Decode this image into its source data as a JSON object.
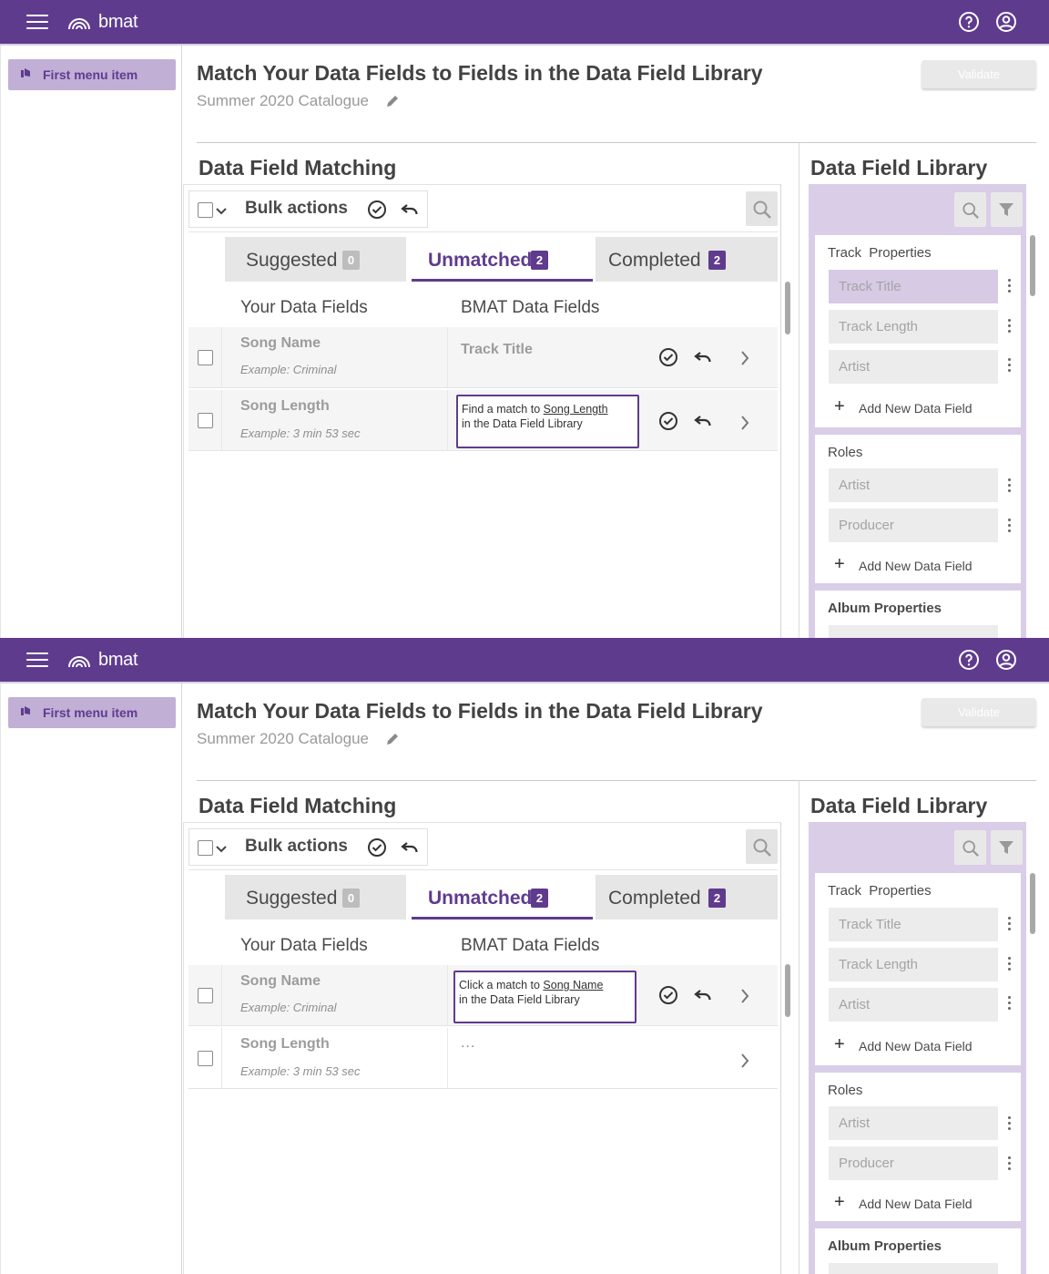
{
  "app": {
    "logo_text": "bmat",
    "brand_color": "#5f3b8e",
    "icons": {
      "menu": "hamburger-icon",
      "help": "help-circle-icon",
      "account": "account-circle-icon"
    }
  },
  "sidebar": {
    "menu_item": "First menu item",
    "menu_item_icon": "reorder-icon"
  },
  "header": {
    "title": "Match Your Data Fields to Fields in the Data Field Library",
    "subtitle": "Summer 2020 Catalogue",
    "validate_label": "Validate"
  },
  "matching": {
    "title": "Data Field Matching",
    "bulk_label": "Bulk actions",
    "tabs": [
      {
        "label": "Suggested",
        "count": "0",
        "badge_color": "#bdbdbd"
      },
      {
        "label": "Unmatched",
        "count": "2",
        "badge_color": "#5f3b8e",
        "active": true
      },
      {
        "label": "Completed",
        "count": "2",
        "badge_color": "#5f3b8e"
      }
    ],
    "col_your": "Your Data Fields",
    "col_bmat": "BMAT Data Fields"
  },
  "panels": [
    {
      "rows": [
        {
          "name": "Song Name",
          "example": "Example: Criminal",
          "bmat": "Track Title"
        },
        {
          "name": "Song Length",
          "example": "Example: 3 min 53 sec"
        }
      ],
      "tooltip": {
        "prefix": "Find a match to",
        "field": "Song Length",
        "suffix": "in the Data Field Library"
      }
    },
    {
      "rows": [
        {
          "name": "Song Name",
          "example": "Example: Criminal"
        },
        {
          "name": "Song Length",
          "example": "Example: 3 min 53 sec",
          "bmat": "..."
        }
      ],
      "tooltip": {
        "prefix": "Click a match to",
        "field": "Song Name",
        "suffix": "in the Data Field Library"
      }
    }
  ],
  "library": {
    "title": "Data Field Library",
    "groups": [
      {
        "title": "Track  Properties",
        "items": [
          "Track Title",
          "Track Length",
          "Artist"
        ],
        "add_label": "Add New Data Field"
      },
      {
        "title": "Roles",
        "items": [
          "Artist",
          "Producer"
        ],
        "add_label": "Add New Data Field"
      },
      {
        "title": "Album Properties"
      }
    ]
  }
}
